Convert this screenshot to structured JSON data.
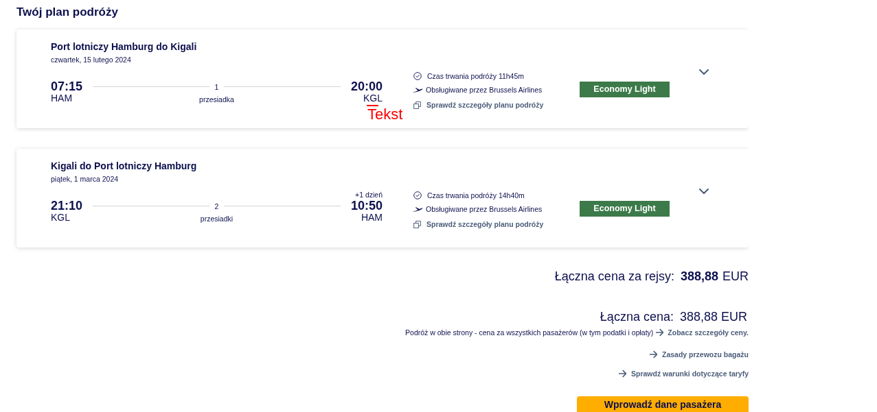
{
  "title": "Twój plan podróży",
  "flights": [
    {
      "route": "Port lotniczy Hamburg do Kigali",
      "date": "czwartek, 15 lutego 2024",
      "departure": {
        "time": "07:15",
        "airport": "HAM"
      },
      "stops": {
        "count": "1",
        "label": "przesiadka"
      },
      "arrival": {
        "time": "20:00",
        "airport": "KGL"
      },
      "annotation": "Tekst",
      "duration": "Czas trwania podróży 11h45m",
      "operator": "Obsługiwane przez Brussels Airlines",
      "details_link": "Sprawdź szczegóły planu podróży",
      "fare": "Economy Light",
      "expanded": false
    },
    {
      "route": "Kigali do Port lotniczy Hamburg",
      "date": "piątek, 1 marca 2024",
      "departure": {
        "time": "21:10",
        "airport": "KGL"
      },
      "stops": {
        "count": "2",
        "label": "przesiadki"
      },
      "arrival": {
        "day_offset": "+1 dzień",
        "time": "10:50",
        "airport": "HAM"
      },
      "duration": "Czas trwania podróży 14h40m",
      "operator": "Obsługiwane przez Brussels Airlines",
      "details_link": "Sprawdź szczegóły planu podróży",
      "fare": "Economy Light",
      "expanded": false
    }
  ],
  "summary": {
    "flights_total": {
      "label": "Łączna cena za rejsy:",
      "amount": "388,88",
      "currency": "EUR"
    },
    "total": {
      "label": "Łączna cena:",
      "value": "388,88 EUR"
    },
    "note": "Podróż w obie strony - cena za wszystkich pasażerów (w tym podatki i opłaty)",
    "price_details_link": "Zobacz szczegóły ceny.",
    "links": [
      "Zasady przewozu bagażu",
      "Sprawdź warunki dotyczące taryfy"
    ]
  },
  "continue_button": "Wprowadź dane pasażera"
}
